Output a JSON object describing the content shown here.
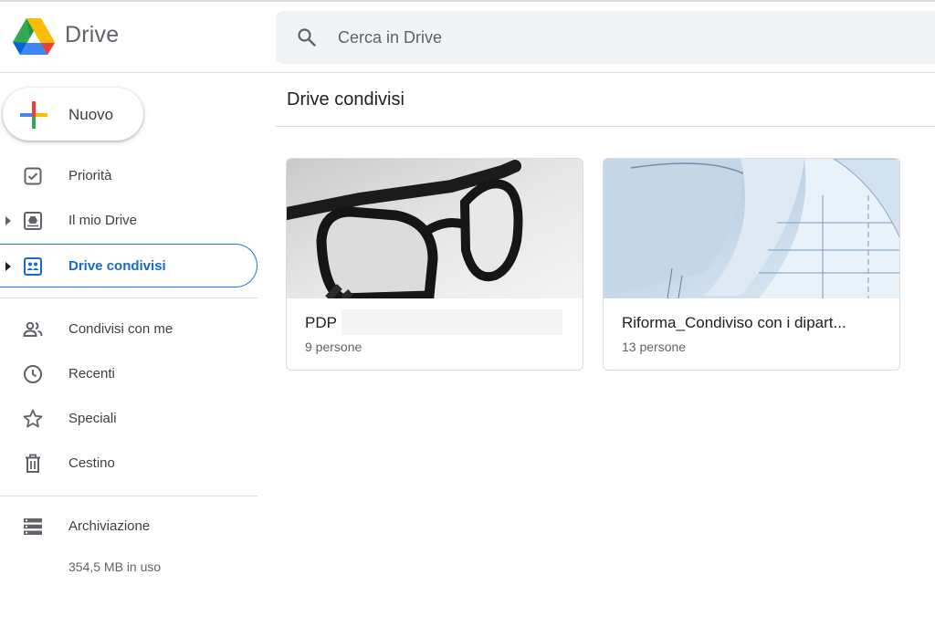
{
  "app": {
    "brand": "Drive"
  },
  "search": {
    "placeholder": "Cerca in Drive"
  },
  "sidebar": {
    "new_label": "Nuovo",
    "items": [
      {
        "label": "Priorità",
        "icon": "priority-check-icon"
      },
      {
        "label": "Il mio Drive",
        "icon": "my-drive-icon"
      },
      {
        "label": "Drive condivisi",
        "icon": "shared-drives-icon",
        "active": true
      },
      {
        "label": "Condivisi con me",
        "icon": "people-icon"
      },
      {
        "label": "Recenti",
        "icon": "clock-icon"
      },
      {
        "label": "Speciali",
        "icon": "star-icon"
      },
      {
        "label": "Cestino",
        "icon": "trash-icon"
      },
      {
        "label": "Archiviazione",
        "icon": "storage-icon"
      }
    ],
    "storage_usage": "354,5 MB in uso"
  },
  "main": {
    "title": "Drive condivisi",
    "cards": [
      {
        "name": "PDP",
        "members": "9 persone",
        "thumbnail": "glasses-photo"
      },
      {
        "name": "Riforma_Condiviso con i dipart...",
        "members": "13 persone",
        "thumbnail": "blueprint-photo"
      }
    ]
  },
  "colors": {
    "accent": "#1a73e8",
    "active_text": "#1967d2",
    "search_bg": "#f1f3f4",
    "divider": "#dadce0"
  }
}
